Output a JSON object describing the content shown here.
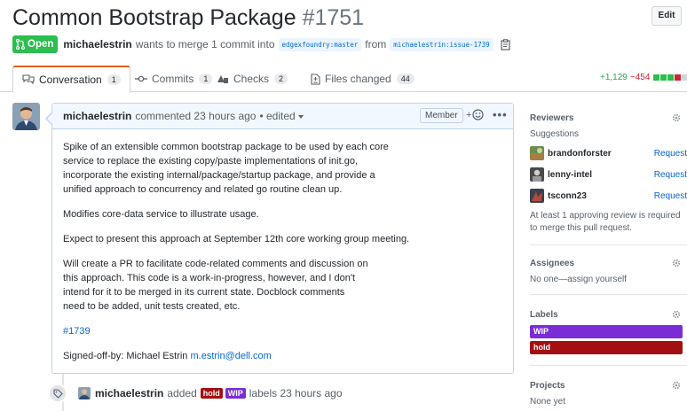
{
  "header": {
    "title": "Common Bootstrap Package",
    "number": "#1751",
    "edit_label": "Edit"
  },
  "meta": {
    "state": "Open",
    "author": "michaelestrin",
    "text": "wants to merge 1 commit into",
    "base_branch": "edgexfoundry:master",
    "from_text": "from",
    "head_branch": "michaelestrin:issue-1739"
  },
  "tabs": [
    {
      "label": "Conversation",
      "count": "1"
    },
    {
      "label": "Commits",
      "count": "1"
    },
    {
      "label": "Checks",
      "count": "2"
    },
    {
      "label": "Files changed",
      "count": "44"
    }
  ],
  "diffstat": {
    "additions": "+1,129",
    "deletions": "−454"
  },
  "comment": {
    "author": "michaelestrin",
    "action": "commented 23 hours ago",
    "edited": "• edited",
    "role": "Member",
    "more": "•••",
    "paragraphs": [
      "Spike of an extensible common bootstrap package to be used by each core\nservice to replace the existing copy/paste implementations of init.go,\nincorporate the existing internal/package/startup package, and provide a\nunified approach to concurrency and related go routine clean up.",
      "Modifies core-data service to illustrate usage.",
      "Expect to present this approach at September 12th core working group meeting.",
      "Will create a PR to facilitate code-related comments and discussion on\nthis approach. This code is a work-in-progress, however, and I don't\nintend for it to be merged in its current state. Docblock comments\nneed to be added, unit tests created, etc."
    ],
    "issue_link": "#1739",
    "signoff_text": "Signed-off-by: Michael Estrin",
    "signoff_email": "m.estrin@dell.com"
  },
  "event": {
    "author": "michaelestrin",
    "added": "added",
    "label1": "hold",
    "label2": "WIP",
    "suffix": "labels 23 hours ago"
  },
  "sidebar": {
    "reviewers": {
      "title": "Reviewers",
      "suggestions": "Suggestions",
      "people": [
        {
          "name": "brandonforster",
          "action": "Request"
        },
        {
          "name": "lenny-intel",
          "action": "Request"
        },
        {
          "name": "tsconn23",
          "action": "Request"
        }
      ],
      "note": "At least 1 approving review is required to merge this pull request."
    },
    "assignees": {
      "title": "Assignees",
      "text": "No one—assign yourself"
    },
    "labels": {
      "title": "Labels",
      "items": [
        {
          "name": "WIP"
        },
        {
          "name": "hold"
        }
      ]
    },
    "projects": {
      "title": "Projects",
      "text": "None yet"
    }
  },
  "colors": {
    "open_green": "#2cbe4e",
    "link_blue": "#0366d6",
    "wip_purple": "#7a2dd6",
    "hold_red": "#a40f12",
    "active_tab_orange": "#e36209"
  }
}
